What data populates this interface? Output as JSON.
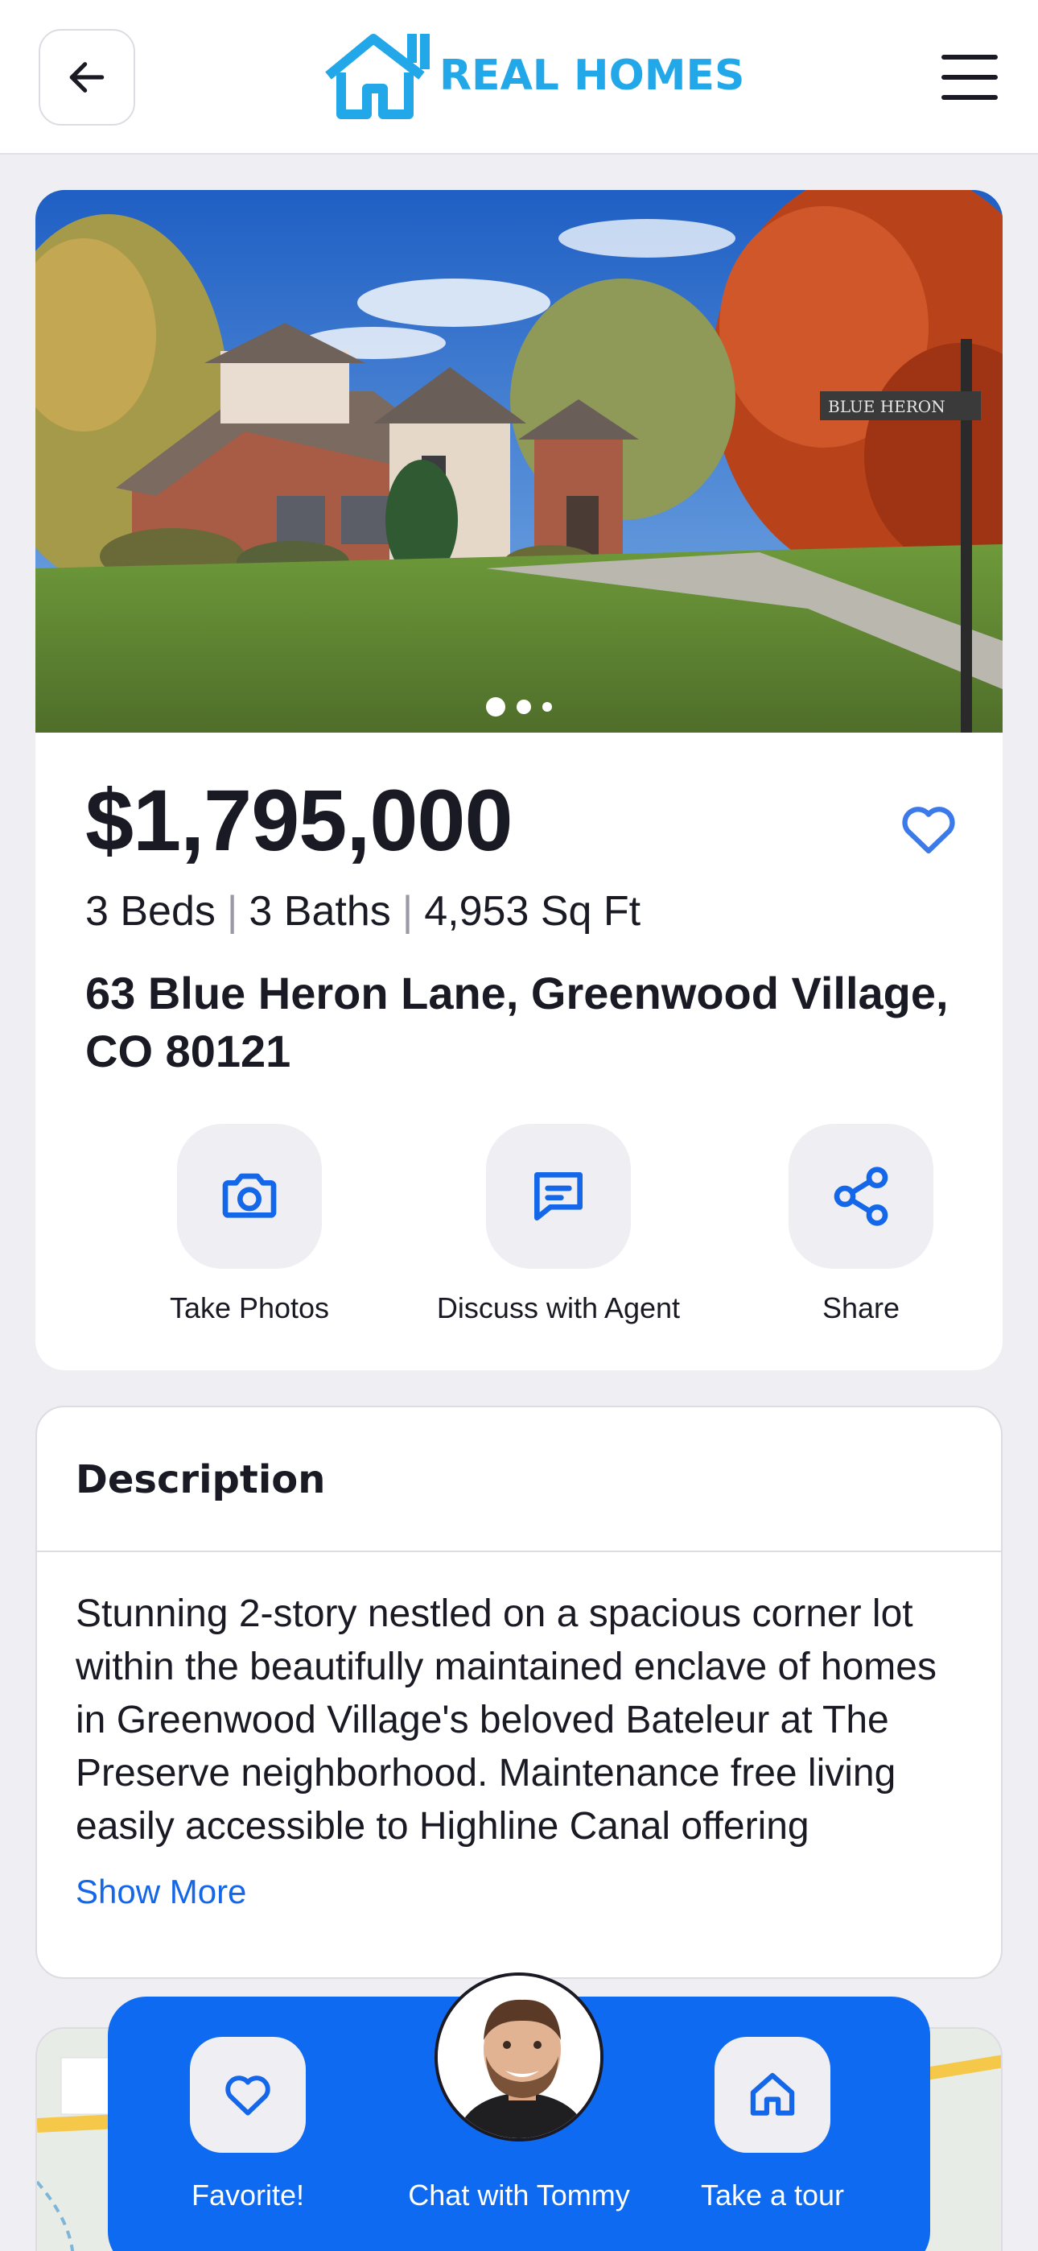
{
  "header": {
    "logo_text": "REAL HOMES"
  },
  "listing": {
    "price": "$1,795,000",
    "specs": [
      "3 Beds",
      "3 Baths",
      "4,953 Sq Ft"
    ],
    "address": "63 Blue Heron Lane, Greenwood Village, CO 80121",
    "photo_sign_text": "BLUE HERON",
    "photo_count": 3,
    "photo_active_index": 1,
    "actions": [
      {
        "label": "Take Photos",
        "icon": "camera-icon"
      },
      {
        "label": "Discuss with Agent",
        "icon": "message-icon"
      },
      {
        "label": "Share",
        "icon": "share-icon"
      }
    ]
  },
  "description": {
    "title": "Description",
    "text": "Stunning 2-story nestled on a spacious corner lot within the beautifully maintained enclave of homes in Greenwood Village's beloved Bateleur at The Preserve neighborhood. Maintenance free living easily accessible to Highline Canal offering",
    "show_more_label": "Show More"
  },
  "bottom_bar": {
    "favorite_label": "Favorite!",
    "chat_label": "Chat with Tommy",
    "tour_label": "Take a tour"
  },
  "colors": {
    "brand_blue": "#0e6af0",
    "logo_blue": "#22a7e8",
    "link_blue": "#1467e8",
    "icon_blue": "#1467e8"
  }
}
